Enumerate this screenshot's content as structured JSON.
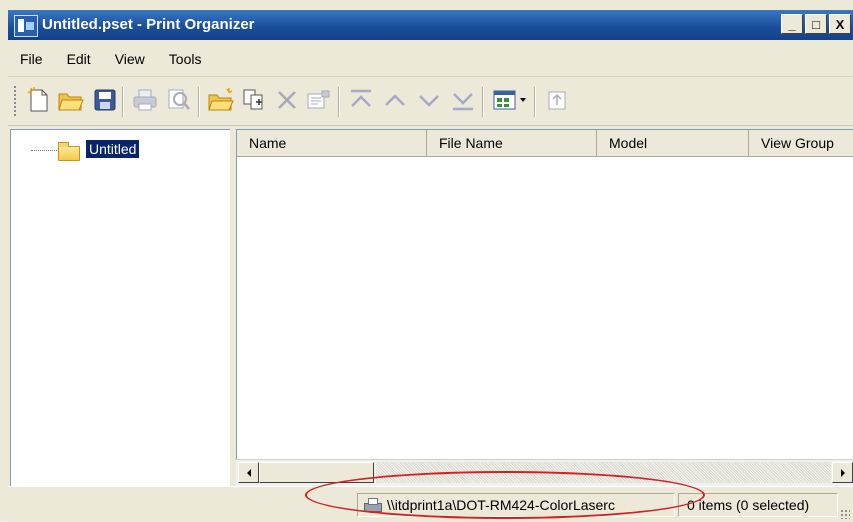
{
  "window": {
    "title": "Untitled.pset - Print Organizer"
  },
  "window_buttons": {
    "minimize": "_",
    "maximize": "□",
    "close": "X"
  },
  "menubar": [
    "File",
    "Edit",
    "View",
    "Tools"
  ],
  "toolbar": {
    "icons": [
      "new-file-icon",
      "open-folder-icon",
      "save-icon",
      "print-icon",
      "print-preview-icon",
      "add-folder-icon",
      "add-files-icon",
      "delete-icon",
      "properties-icon",
      "move-to-top-icon",
      "move-up-icon",
      "move-down-icon",
      "move-to-bottom-icon",
      "view-options-icon",
      "dropdown-arrow-icon",
      "export-icon"
    ]
  },
  "tree": {
    "root_label": "Untitled"
  },
  "table": {
    "columns": [
      "Name",
      "File Name",
      "Model",
      "View Group"
    ]
  },
  "status": {
    "printer": "\\\\itdprint1a\\DOT-RM424-ColorLaserc",
    "items": "0 items (0 selected)"
  },
  "colors": {
    "title_bar": "#1a4f9c",
    "selection": "#0a246a",
    "annotation": "#d32020"
  }
}
